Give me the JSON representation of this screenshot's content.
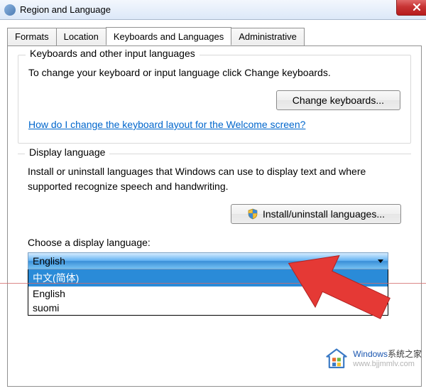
{
  "window": {
    "title": "Region and Language"
  },
  "tabs": {
    "0": {
      "label": "Formats"
    },
    "1": {
      "label": "Location"
    },
    "2": {
      "label": "Keyboards and Languages"
    },
    "3": {
      "label": "Administrative"
    }
  },
  "keyboards_group": {
    "legend": "Keyboards and other input languages",
    "description": "To change your keyboard or input language click Change keyboards.",
    "button": "Change keyboards...",
    "help_link": "How do I change the keyboard layout for the Welcome screen?"
  },
  "display_group": {
    "legend": "Display language",
    "description": "Install or uninstall languages that Windows can use to display text and where supported recognize speech and handwriting.",
    "button": "Install/uninstall languages...",
    "choose_label": "Choose a display language:",
    "dropdown": {
      "selected": "English",
      "options": {
        "0": "中文(简体)",
        "1": "English",
        "2": "suomi"
      }
    }
  },
  "watermark": {
    "brand": "Windows",
    "suffix": "系统之家",
    "url": "www.bjjmmlv.com"
  }
}
